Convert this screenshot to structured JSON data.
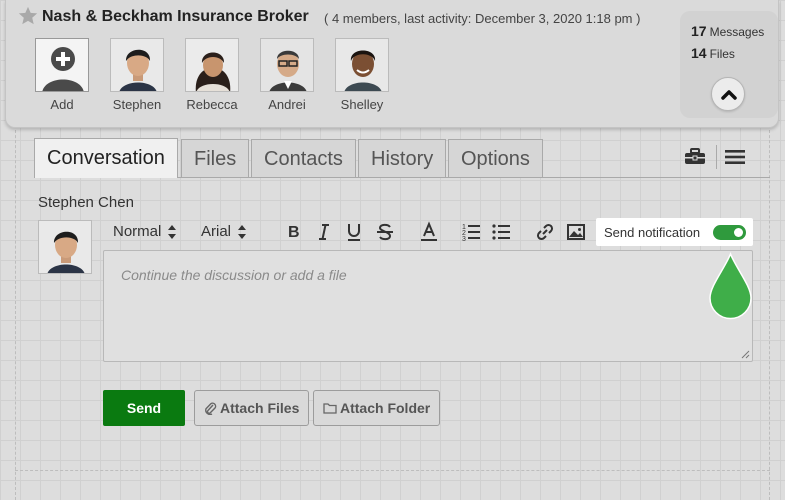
{
  "header": {
    "title": "Nash & Beckham Insurance Broker",
    "meta": "( 4 members, last activity: December 3, 2020 1:18 pm )",
    "members": [
      {
        "name": "Add",
        "kind": "add-icon"
      },
      {
        "name": "Stephen",
        "kind": "photo"
      },
      {
        "name": "Rebecca",
        "kind": "photo"
      },
      {
        "name": "Andrei",
        "kind": "photo"
      },
      {
        "name": "Shelley",
        "kind": "photo"
      }
    ],
    "stats": {
      "messages_count": "17",
      "messages_label": "Messages",
      "files_count": "14",
      "files_label": "Files"
    }
  },
  "tabs": [
    {
      "label": "Conversation",
      "active": true
    },
    {
      "label": "Files",
      "active": false
    },
    {
      "label": "Contacts",
      "active": false
    },
    {
      "label": "History",
      "active": false
    },
    {
      "label": "Options",
      "active": false
    }
  ],
  "toolbar_icons": [
    "briefcase-icon",
    "hamburger-menu-icon"
  ],
  "composer": {
    "author": "Stephen Chen",
    "format_select": "Normal",
    "font_select": "Arial",
    "format_buttons": [
      "bold-icon",
      "italic-icon",
      "underline-icon",
      "strikethrough-icon",
      "text-color-icon",
      "ordered-list-icon",
      "bullet-list-icon",
      "link-icon",
      "image-icon"
    ],
    "notification_label": "Send notification",
    "notification_on": true,
    "placeholder": "Continue the discussion or add a file"
  },
  "actions": {
    "send": "Send",
    "attach_files": "Attach Files",
    "attach_folder": "Attach Folder"
  },
  "colors": {
    "send_button": "#0a7a10",
    "toggle_on": "#2f9a3d",
    "drop_marker": "#3fae49"
  }
}
